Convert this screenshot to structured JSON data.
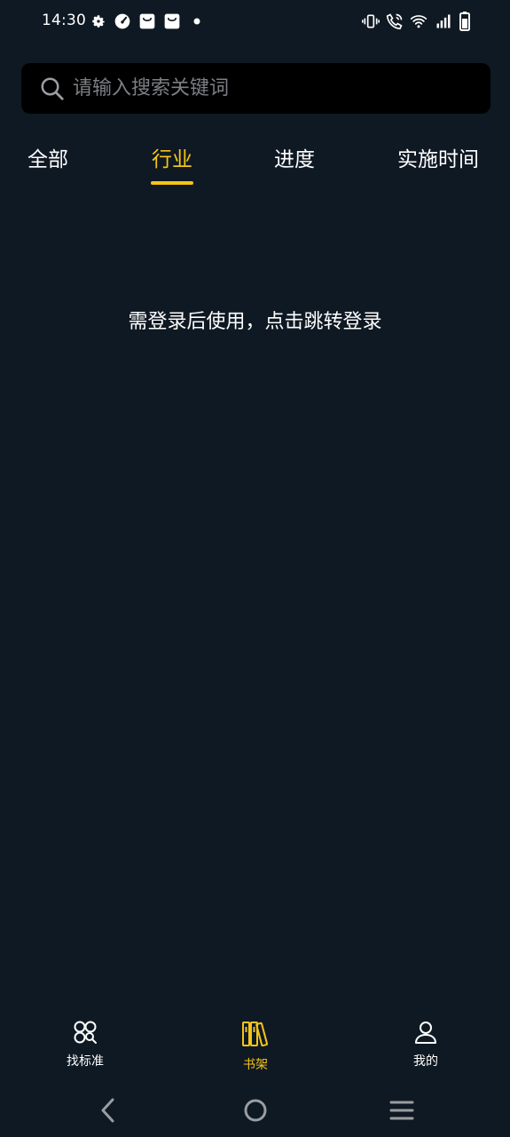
{
  "status_bar": {
    "time": "14:30",
    "left_icons": [
      "gear-icon",
      "speedometer-icon",
      "shopping-bag-icon",
      "shopping-bag-icon",
      "dot-icon"
    ],
    "right_icons": [
      "vibrate-icon",
      "wifi-call-icon",
      "wifi-icon",
      "signal-icon",
      "battery-icon"
    ]
  },
  "search": {
    "placeholder": "请输入搜索关键词",
    "value": ""
  },
  "tabs": [
    {
      "label": "全部",
      "active": false
    },
    {
      "label": "行业",
      "active": true
    },
    {
      "label": "进度",
      "active": false
    },
    {
      "label": "实施时间",
      "active": false
    }
  ],
  "main": {
    "login_prompt": "需登录后使用，点击跳转登录"
  },
  "bottom_nav": [
    {
      "label": "找标准",
      "icon": "find-standards-icon",
      "active": false
    },
    {
      "label": "书架",
      "icon": "bookshelf-icon",
      "active": true
    },
    {
      "label": "我的",
      "icon": "user-icon",
      "active": false
    }
  ],
  "system_nav": [
    "back-icon",
    "home-icon",
    "menu-icon"
  ],
  "colors": {
    "background": "#0f1923",
    "search_background": "#000000",
    "accent": "#f5c518",
    "text": "#ffffff",
    "placeholder": "#7c7f84"
  }
}
